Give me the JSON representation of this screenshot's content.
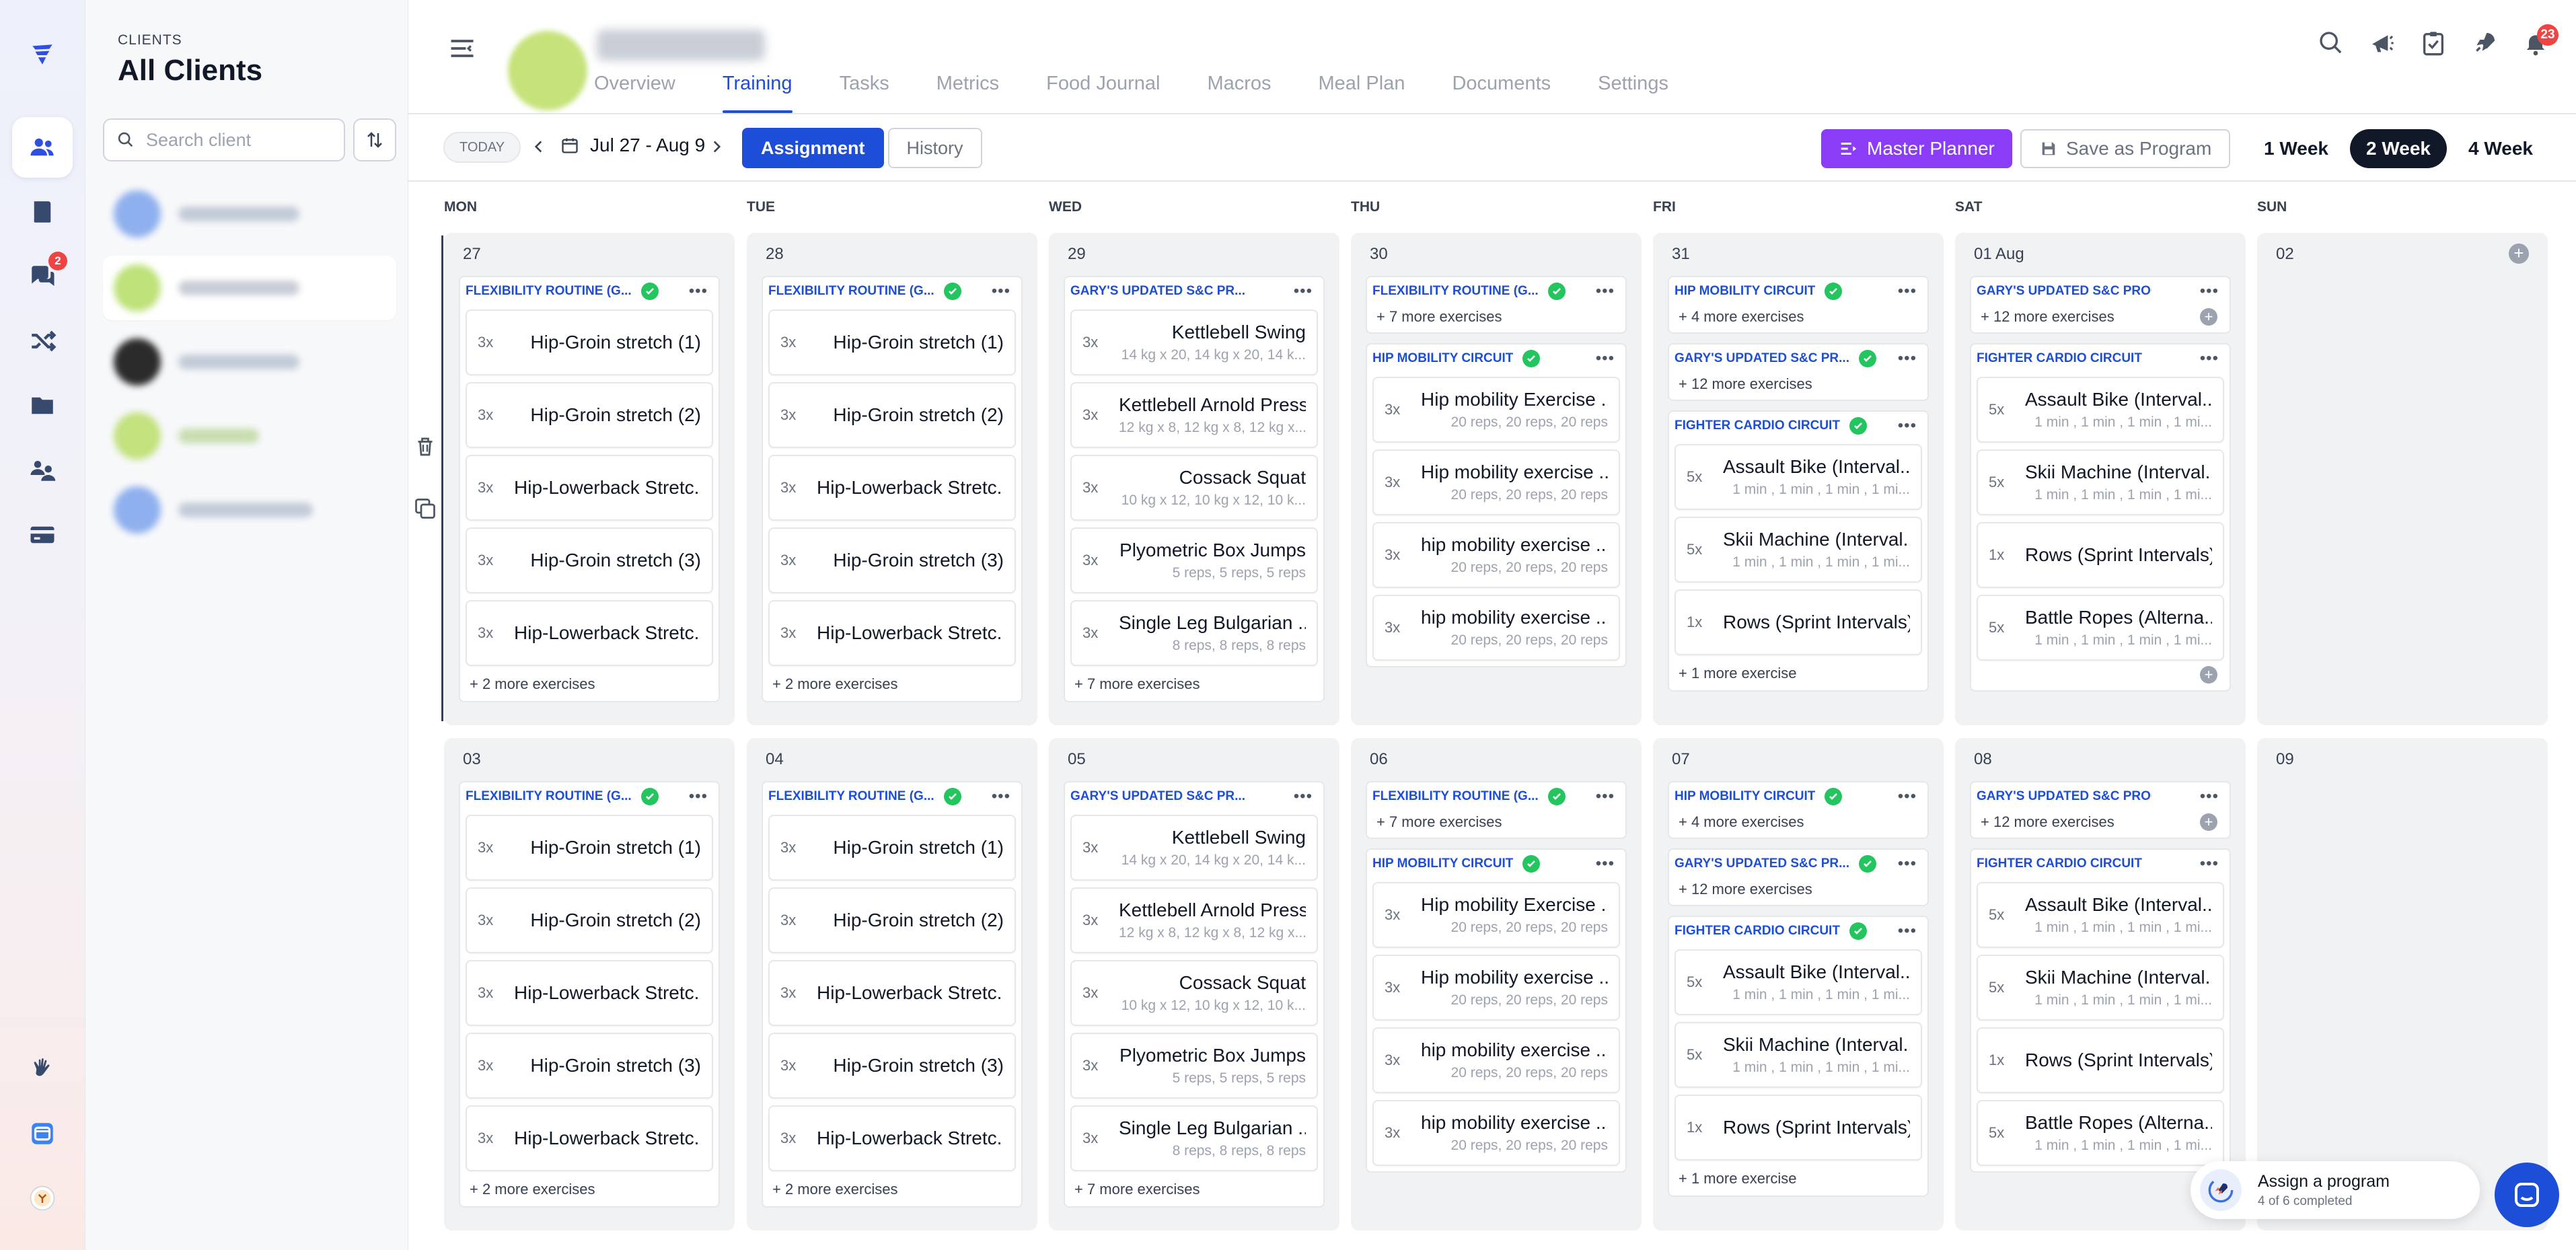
{
  "clients_panel": {
    "eyebrow": "CLIENTS",
    "title": "All Clients",
    "search_placeholder": "Search client"
  },
  "colors": {
    "accent": "#1d4ed8",
    "master_planner": "#8b3cf6",
    "done": "#22c55e",
    "badge": "#ef4444"
  },
  "sidebar_badges": {
    "messages": "2"
  },
  "tabs": [
    "Overview",
    "Training",
    "Tasks",
    "Metrics",
    "Food Journal",
    "Macros",
    "Meal Plan",
    "Documents",
    "Settings"
  ],
  "active_tab": "Training",
  "notifications_count": "23",
  "toolbar": {
    "today": "TODAY",
    "date_range": "Jul 27 - Aug 9",
    "assignment": "Assignment",
    "history": "History",
    "master_planner": "Master Planner",
    "save_program": "Save as Program",
    "week_options": [
      "1 Week",
      "2 Week",
      "4 Week"
    ],
    "selected_week": "2 Week"
  },
  "day_names": [
    "MON",
    "TUE",
    "WED",
    "THU",
    "FRI",
    "SAT",
    "SUN"
  ],
  "weeks": [
    {
      "days": [
        {
          "num": "27",
          "cards": [
            {
              "title": "FLEXIBILITY ROUTINE (G...",
              "done": true,
              "exercises": [
                {
                  "sets": "3x",
                  "name": "Hip-Groin stretch (1)"
                },
                {
                  "sets": "3x",
                  "name": "Hip-Groin stretch (2)"
                },
                {
                  "sets": "3x",
                  "name": "Hip-Lowerback Stretc..."
                },
                {
                  "sets": "3x",
                  "name": "Hip-Groin stretch (3)"
                },
                {
                  "sets": "3x",
                  "name": "Hip-Lowerback Stretc..."
                }
              ],
              "more": "+ 2 more exercises"
            }
          ]
        },
        {
          "num": "28",
          "cards": [
            {
              "title": "FLEXIBILITY ROUTINE (G...",
              "done": true,
              "exercises": [
                {
                  "sets": "3x",
                  "name": "Hip-Groin stretch (1)"
                },
                {
                  "sets": "3x",
                  "name": "Hip-Groin stretch (2)"
                },
                {
                  "sets": "3x",
                  "name": "Hip-Lowerback Stretc..."
                },
                {
                  "sets": "3x",
                  "name": "Hip-Groin stretch (3)"
                },
                {
                  "sets": "3x",
                  "name": "Hip-Lowerback Stretc..."
                }
              ],
              "more": "+ 2 more exercises"
            }
          ]
        },
        {
          "num": "29",
          "cards": [
            {
              "title": "GARY'S UPDATED S&C PR...",
              "done": false,
              "exercises": [
                {
                  "sets": "3x",
                  "name": "Kettlebell Swing",
                  "sub": "14 kg x 20, 14 kg x 20, 14 k..."
                },
                {
                  "sets": "3x",
                  "name": "Kettlebell Arnold Press",
                  "sub": "12 kg x 8, 12 kg x 8, 12 kg x..."
                },
                {
                  "sets": "3x",
                  "name": "Cossack Squat",
                  "sub": "10 kg x 12, 10 kg x 12, 10 k..."
                },
                {
                  "sets": "3x",
                  "name": "Plyometric Box Jumps",
                  "sub": "5 reps, 5 reps, 5 reps"
                },
                {
                  "sets": "3x",
                  "name": "Single Leg Bulgarian ...",
                  "sub": "8 reps, 8 reps, 8 reps"
                }
              ],
              "more": "+ 7 more exercises"
            }
          ]
        },
        {
          "num": "30",
          "cards": [
            {
              "title": "FLEXIBILITY ROUTINE (G...",
              "done": true,
              "exercises": [],
              "more": "+ 7 more exercises"
            },
            {
              "title": "HIP MOBILITY CIRCUIT",
              "done": true,
              "exercises": [
                {
                  "sets": "3x",
                  "name": "Hip mobility Exercise ...",
                  "sub": "20 reps, 20 reps, 20 reps"
                },
                {
                  "sets": "3x",
                  "name": "Hip mobility exercise ...",
                  "sub": "20 reps, 20 reps, 20 reps"
                },
                {
                  "sets": "3x",
                  "name": "hip mobility exercise ...",
                  "sub": "20 reps, 20 reps, 20 reps"
                },
                {
                  "sets": "3x",
                  "name": "hip mobility exercise ...",
                  "sub": "20 reps, 20 reps, 20 reps"
                }
              ]
            }
          ]
        },
        {
          "num": "31",
          "cards": [
            {
              "title": "HIP MOBILITY CIRCUIT",
              "done": true,
              "exercises": [],
              "more": "+ 4 more exercises"
            },
            {
              "title": "GARY'S UPDATED S&C PR...",
              "done": true,
              "exercises": [],
              "more": "+ 12 more exercises"
            },
            {
              "title": "FIGHTER CARDIO CIRCUIT",
              "done": true,
              "exercises": [
                {
                  "sets": "5x",
                  "name": "Assault Bike (Interval...",
                  "sub": "1 min , 1 min , 1 min , 1 mi..."
                },
                {
                  "sets": "5x",
                  "name": "Skii Machine (Interval...",
                  "sub": "1 min , 1 min , 1 min , 1 mi..."
                },
                {
                  "sets": "1x",
                  "name": "Rows (Sprint Intervals)"
                }
              ],
              "more": "+ 1 more exercise"
            }
          ]
        },
        {
          "num": "01 Aug",
          "cards": [
            {
              "title": "GARY'S UPDATED S&C PROG...",
              "done": false,
              "exercises": [],
              "more": "+ 12 more exercises",
              "plus": true
            },
            {
              "title": "FIGHTER CARDIO CIRCUIT",
              "done": false,
              "exercises": [
                {
                  "sets": "5x",
                  "name": "Assault Bike (Interval...",
                  "sub": "1 min , 1 min , 1 min , 1 mi..."
                },
                {
                  "sets": "5x",
                  "name": "Skii Machine (Interval...",
                  "sub": "1 min , 1 min , 1 min , 1 mi..."
                },
                {
                  "sets": "1x",
                  "name": "Rows (Sprint Intervals)"
                },
                {
                  "sets": "5x",
                  "name": "Battle Ropes (Alterna...",
                  "sub": "1 min , 1 min , 1 min , 1 mi..."
                }
              ],
              "plus": true
            }
          ]
        },
        {
          "num": "02",
          "cards": [],
          "add": true
        }
      ]
    },
    {
      "days": [
        {
          "num": "03",
          "cards": [
            {
              "title": "FLEXIBILITY ROUTINE (G...",
              "done": true,
              "exercises": [
                {
                  "sets": "3x",
                  "name": "Hip-Groin stretch (1)"
                },
                {
                  "sets": "3x",
                  "name": "Hip-Groin stretch (2)"
                },
                {
                  "sets": "3x",
                  "name": "Hip-Lowerback Stretc..."
                },
                {
                  "sets": "3x",
                  "name": "Hip-Groin stretch (3)"
                },
                {
                  "sets": "3x",
                  "name": "Hip-Lowerback Stretc..."
                }
              ],
              "more": "+ 2 more exercises"
            }
          ]
        },
        {
          "num": "04",
          "cards": [
            {
              "title": "FLEXIBILITY ROUTINE (G...",
              "done": true,
              "exercises": [
                {
                  "sets": "3x",
                  "name": "Hip-Groin stretch (1)"
                },
                {
                  "sets": "3x",
                  "name": "Hip-Groin stretch (2)"
                },
                {
                  "sets": "3x",
                  "name": "Hip-Lowerback Stretc..."
                },
                {
                  "sets": "3x",
                  "name": "Hip-Groin stretch (3)"
                },
                {
                  "sets": "3x",
                  "name": "Hip-Lowerback Stretc..."
                }
              ],
              "more": "+ 2 more exercises"
            }
          ]
        },
        {
          "num": "05",
          "cards": [
            {
              "title": "GARY'S UPDATED S&C PR...",
              "done": false,
              "exercises": [
                {
                  "sets": "3x",
                  "name": "Kettlebell Swing",
                  "sub": "14 kg x 20, 14 kg x 20, 14 k..."
                },
                {
                  "sets": "3x",
                  "name": "Kettlebell Arnold Press",
                  "sub": "12 kg x 8, 12 kg x 8, 12 kg x..."
                },
                {
                  "sets": "3x",
                  "name": "Cossack Squat",
                  "sub": "10 kg x 12, 10 kg x 12, 10 k..."
                },
                {
                  "sets": "3x",
                  "name": "Plyometric Box Jumps",
                  "sub": "5 reps, 5 reps, 5 reps"
                },
                {
                  "sets": "3x",
                  "name": "Single Leg Bulgarian ...",
                  "sub": "8 reps, 8 reps, 8 reps"
                }
              ],
              "more": "+ 7 more exercises"
            }
          ]
        },
        {
          "num": "06",
          "cards": [
            {
              "title": "FLEXIBILITY ROUTINE (G...",
              "done": true,
              "exercises": [],
              "more": "+ 7 more exercises"
            },
            {
              "title": "HIP MOBILITY CIRCUIT",
              "done": true,
              "exercises": [
                {
                  "sets": "3x",
                  "name": "Hip mobility Exercise ...",
                  "sub": "20 reps, 20 reps, 20 reps"
                },
                {
                  "sets": "3x",
                  "name": "Hip mobility exercise ...",
                  "sub": "20 reps, 20 reps, 20 reps"
                },
                {
                  "sets": "3x",
                  "name": "hip mobility exercise ...",
                  "sub": "20 reps, 20 reps, 20 reps"
                },
                {
                  "sets": "3x",
                  "name": "hip mobility exercise ...",
                  "sub": "20 reps, 20 reps, 20 reps"
                }
              ]
            }
          ]
        },
        {
          "num": "07",
          "cards": [
            {
              "title": "HIP MOBILITY CIRCUIT",
              "done": true,
              "exercises": [],
              "more": "+ 4 more exercises"
            },
            {
              "title": "GARY'S UPDATED S&C PR...",
              "done": true,
              "exercises": [],
              "more": "+ 12 more exercises"
            },
            {
              "title": "FIGHTER CARDIO CIRCUIT",
              "done": true,
              "exercises": [
                {
                  "sets": "5x",
                  "name": "Assault Bike (Interval...",
                  "sub": "1 min , 1 min , 1 min , 1 mi..."
                },
                {
                  "sets": "5x",
                  "name": "Skii Machine (Interval...",
                  "sub": "1 min , 1 min , 1 min , 1 mi..."
                },
                {
                  "sets": "1x",
                  "name": "Rows (Sprint Intervals)"
                }
              ],
              "more": "+ 1 more exercise"
            }
          ]
        },
        {
          "num": "08",
          "cards": [
            {
              "title": "GARY'S UPDATED S&C PROG...",
              "done": false,
              "exercises": [],
              "more": "+ 12 more exercises",
              "plus": true
            },
            {
              "title": "FIGHTER CARDIO CIRCUIT",
              "done": false,
              "exercises": [
                {
                  "sets": "5x",
                  "name": "Assault Bike (Interval...",
                  "sub": "1 min , 1 min , 1 min , 1 mi..."
                },
                {
                  "sets": "5x",
                  "name": "Skii Machine (Interval...",
                  "sub": "1 min , 1 min , 1 min , 1 mi..."
                },
                {
                  "sets": "1x",
                  "name": "Rows (Sprint Intervals)"
                },
                {
                  "sets": "5x",
                  "name": "Battle Ropes (Alterna...",
                  "sub": "1 min , 1 min , 1 min , 1 mi..."
                }
              ]
            }
          ]
        },
        {
          "num": "09",
          "cards": []
        }
      ]
    }
  ],
  "assign_widget": {
    "title": "Assign a program",
    "subtitle": "4 of 6 completed"
  }
}
